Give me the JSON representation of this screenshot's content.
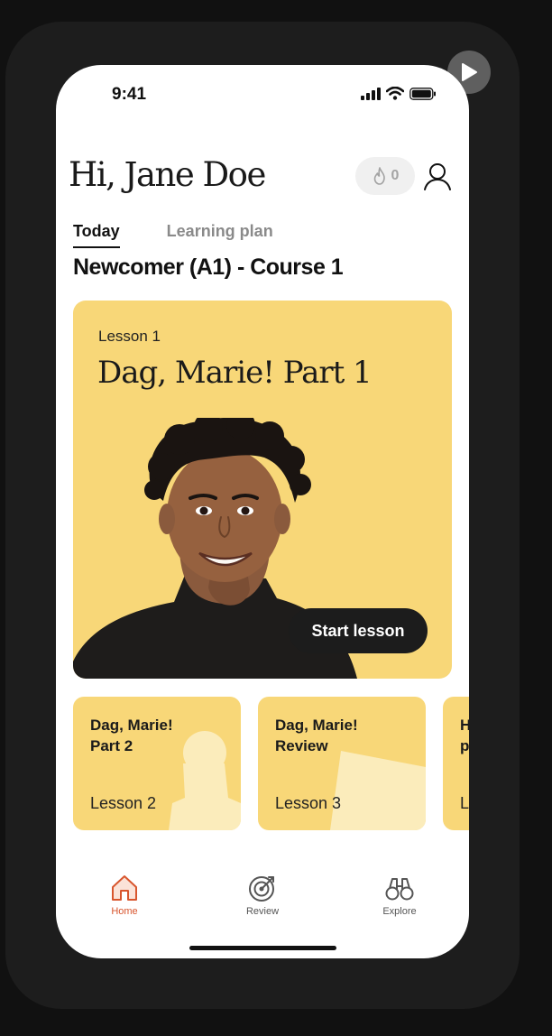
{
  "status_bar": {
    "time": "9:41"
  },
  "header": {
    "greeting": "Hi, Jane Doe",
    "streak_count": "0"
  },
  "tabs": [
    {
      "label": "Today",
      "active": true
    },
    {
      "label": "Learning plan",
      "active": false
    }
  ],
  "course": {
    "title": "Newcomer (A1) - Course 1"
  },
  "hero_lesson": {
    "lesson_label": "Lesson 1",
    "title": "Dag, Marie! Part 1",
    "cta_label": "Start lesson"
  },
  "upcoming_lessons": [
    {
      "title_line1": "Dag, Marie!",
      "title_line2": "Part 2",
      "lesson_label": "Lesson 2"
    },
    {
      "title_line1": "Dag, Marie!",
      "title_line2": "Review",
      "lesson_label": "Lesson 3"
    },
    {
      "title_line1": "H",
      "title_line2": "p",
      "lesson_label": "L"
    }
  ],
  "bottom_nav": [
    {
      "label": "Home",
      "icon": "home-icon",
      "active": true
    },
    {
      "label": "Review",
      "icon": "target-icon",
      "active": false
    },
    {
      "label": "Explore",
      "icon": "binoculars-icon",
      "active": false
    }
  ],
  "colors": {
    "card_yellow": "#f8d778",
    "accent_orange": "#d8562e",
    "button_dark": "#1c1c1c",
    "frame_dark": "#1d1d1d"
  }
}
